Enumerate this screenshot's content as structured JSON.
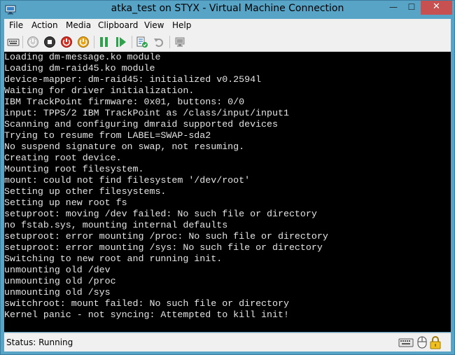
{
  "window": {
    "title": "atka_test on STYX - Virtual Machine Connection",
    "minimize_glyph": "—",
    "maximize_glyph": "☐",
    "close_glyph": "✕"
  },
  "menu": {
    "items": [
      {
        "label": "File"
      },
      {
        "label": "Action"
      },
      {
        "label": "Media"
      },
      {
        "label": "Clipboard"
      },
      {
        "label": "View"
      },
      {
        "label": "Help"
      }
    ]
  },
  "toolbar": {
    "buttons": [
      {
        "icon": "ctrl-alt-del-icon"
      },
      {
        "icon": "start-icon"
      },
      {
        "icon": "turn-off-icon"
      },
      {
        "icon": "shut-down-icon"
      },
      {
        "icon": "power-icon"
      },
      {
        "icon": "pause-icon"
      },
      {
        "icon": "resume-icon"
      },
      {
        "icon": "checkpoint-icon"
      },
      {
        "icon": "revert-icon"
      },
      {
        "icon": "enhanced-session-icon"
      }
    ]
  },
  "console": {
    "lines": [
      "Loading dm-message.ko module",
      "Loading dm-raid45.ko module",
      "device-mapper: dm-raid45: initialized v0.2594l",
      "Waiting for driver initialization.",
      "IBM TrackPoint firmware: 0x01, buttons: 0/0",
      "input: TPPS/2 IBM TrackPoint as /class/input/input1",
      "Scanning and configuring dmraid supported devices",
      "Trying to resume from LABEL=SWAP-sda2",
      "No suspend signature on swap, not resuming.",
      "Creating root device.",
      "Mounting root filesystem.",
      "mount: could not find filesystem '/dev/root'",
      "Setting up other filesystems.",
      "Setting up new root fs",
      "setuproot: moving /dev failed: No such file or directory",
      "no fstab.sys, mounting internal defaults",
      "setuproot: error mounting /proc: No such file or directory",
      "setuproot: error mounting /sys: No such file or directory",
      "Switching to new root and running init.",
      "unmounting old /dev",
      "unmounting old /proc",
      "unmounting old /sys",
      "switchroot: mount failed: No such file or directory",
      "Kernel panic - not syncing: Attempted to kill init!"
    ]
  },
  "status": {
    "text": "Status: Running",
    "icons": [
      "keyboard-icon",
      "mouse-icon",
      "lock-icon"
    ]
  },
  "colors": {
    "chrome": "#58a4c6",
    "console_bg": "#000000",
    "console_fg": "#e4e4e4",
    "close": "#c75050"
  }
}
